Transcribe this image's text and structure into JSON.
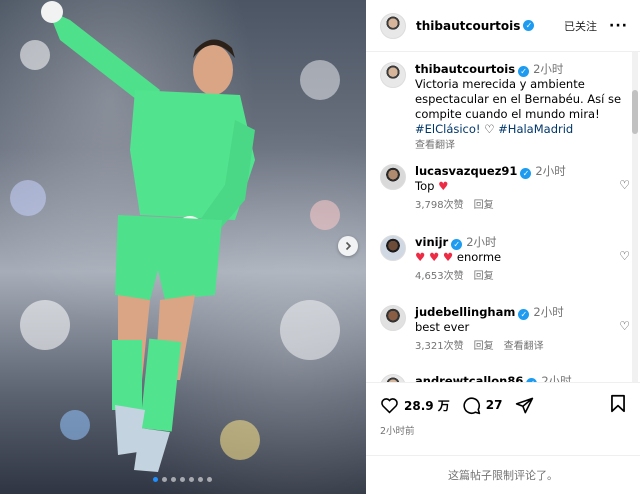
{
  "header": {
    "username": "thibautcourtois",
    "following_label": "已关注",
    "more_label": "···"
  },
  "caption": {
    "username": "thibautcourtois",
    "time": "2小时",
    "text": "Victoria merecida y ambiente espectacular en el Bernabéu. Así se compite cuando el mundo mira!",
    "tag1": "#ElClásico!",
    "tag2": "#HalaMadrid",
    "translate": "查看翻译"
  },
  "comments": [
    {
      "username": "lucasvazquez91",
      "time": "2小时",
      "text": "Top",
      "likes": "3,798次赞",
      "reply": "回复"
    },
    {
      "username": "vinijr",
      "time": "2小时",
      "text": "enorme",
      "likes": "4,653次赞",
      "reply": "回复"
    },
    {
      "username": "judebellingham",
      "time": "2小时",
      "text": "best ever",
      "likes": "3,321次赞",
      "reply": "回复",
      "translate": "查看翻译"
    }
  ],
  "partial_comment": {
    "username": "andrewtcallon86",
    "time": "2小时"
  },
  "actions": {
    "likes": "28.9 万",
    "comments": "27",
    "post_time": "2小时前"
  },
  "comments_limited": "这篇帖子限制评论了。",
  "colors": {
    "verified": "#1d9bf0",
    "heart": "#ed2b45",
    "link": "#00376b",
    "active_dot": "#1e90ff"
  }
}
